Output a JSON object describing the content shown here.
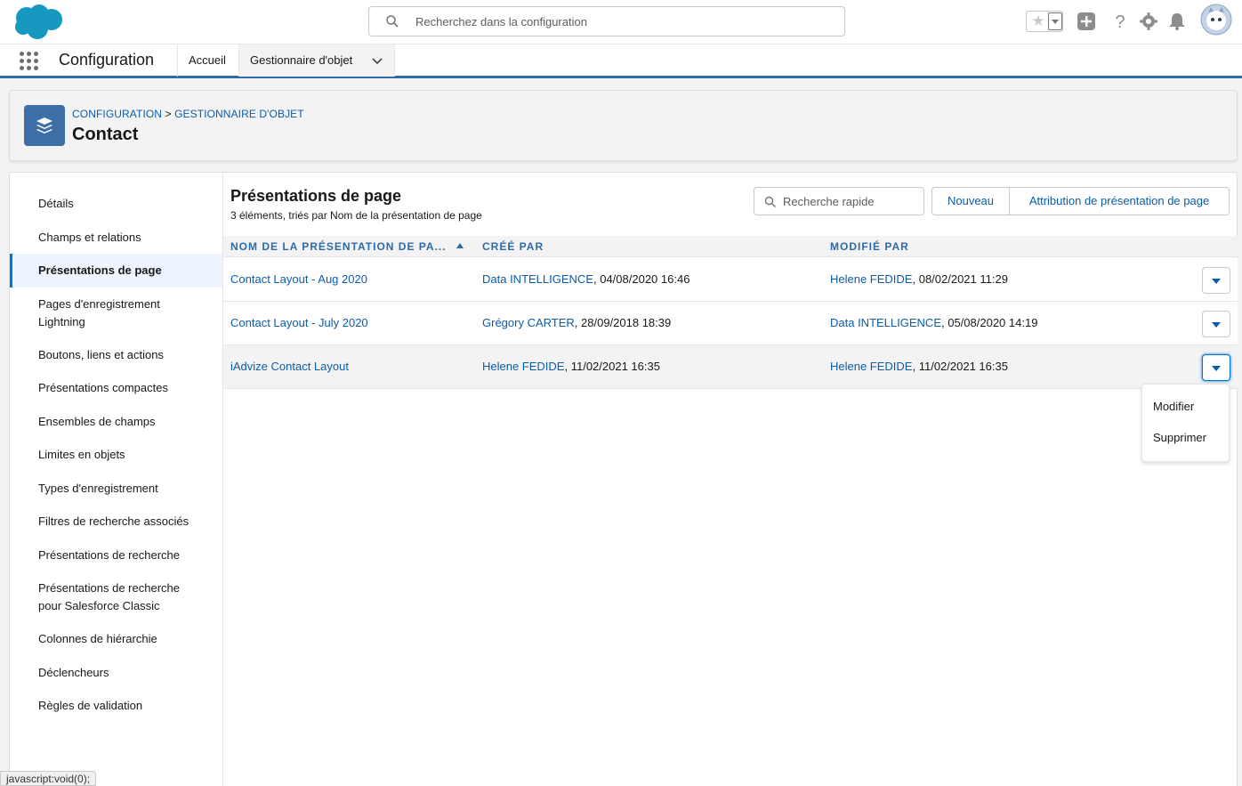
{
  "global_header": {
    "search_placeholder": "Recherchez dans la configuration"
  },
  "context_bar": {
    "app_name": "Configuration",
    "tabs": [
      {
        "label": "Accueil"
      },
      {
        "label": "Gestionnaire d'objet"
      }
    ]
  },
  "page_header": {
    "breadcrumb": {
      "root": "CONFIGURATION",
      "separator": ">",
      "current": "GESTIONNAIRE D'OBJET"
    },
    "title": "Contact"
  },
  "sidebar": {
    "items": [
      {
        "label": "Détails"
      },
      {
        "label": "Champs et relations"
      },
      {
        "label": "Présentations de page"
      },
      {
        "label": "Pages d'enregistrement Lightning"
      },
      {
        "label": "Boutons, liens et actions"
      },
      {
        "label": "Présentations compactes"
      },
      {
        "label": "Ensembles de champs"
      },
      {
        "label": "Limites en objets"
      },
      {
        "label": "Types d'enregistrement"
      },
      {
        "label": "Filtres de recherche associés"
      },
      {
        "label": "Présentations de recherche"
      },
      {
        "label": "Présentations de recherche pour Salesforce Classic"
      },
      {
        "label": "Colonnes de hiérarchie"
      },
      {
        "label": "Déclencheurs"
      },
      {
        "label": "Règles de validation"
      }
    ],
    "active_index": 2
  },
  "content": {
    "title": "Présentations de page",
    "subtitle": "3 éléments, triés par Nom de la présentation de page",
    "quick_search_placeholder": "Recherche rapide",
    "buttons": {
      "new": "Nouveau",
      "assign": "Attribution de présentation de page"
    },
    "columns": [
      "NOM DE LA PRÉSENTATION DE PA...",
      "CRÉÉ PAR",
      "MODIFIÉ PAR"
    ],
    "rows": [
      {
        "name": "Contact Layout - Aug 2020",
        "created_by": "Data INTELLIGENCE",
        "created_at": ", 04/08/2020 16:46",
        "modified_by": "Helene FEDIDE",
        "modified_at": ", 08/02/2021 11:29"
      },
      {
        "name": "Contact Layout - July 2020",
        "created_by": "Grégory CARTER",
        "created_at": ", 28/09/2018 18:39",
        "modified_by": "Data INTELLIGENCE",
        "modified_at": ", 05/08/2020 14:19"
      },
      {
        "name": "iAdvize Contact Layout",
        "created_by": "Helene FEDIDE",
        "created_at": ", 11/02/2021 16:35",
        "modified_by": "Helene FEDIDE",
        "modified_at": ", 11/02/2021 16:35"
      }
    ],
    "row_menu": {
      "edit": "Modifier",
      "delete": "Supprimer"
    }
  },
  "status_bar": {
    "text": "javascript:void(0);"
  },
  "colors": {
    "link": "#0b5cab",
    "brand": "#0176d3",
    "header_text": "#2e6aa8",
    "object_icon": "#3c6fa5",
    "cloud": "#1798c1"
  }
}
